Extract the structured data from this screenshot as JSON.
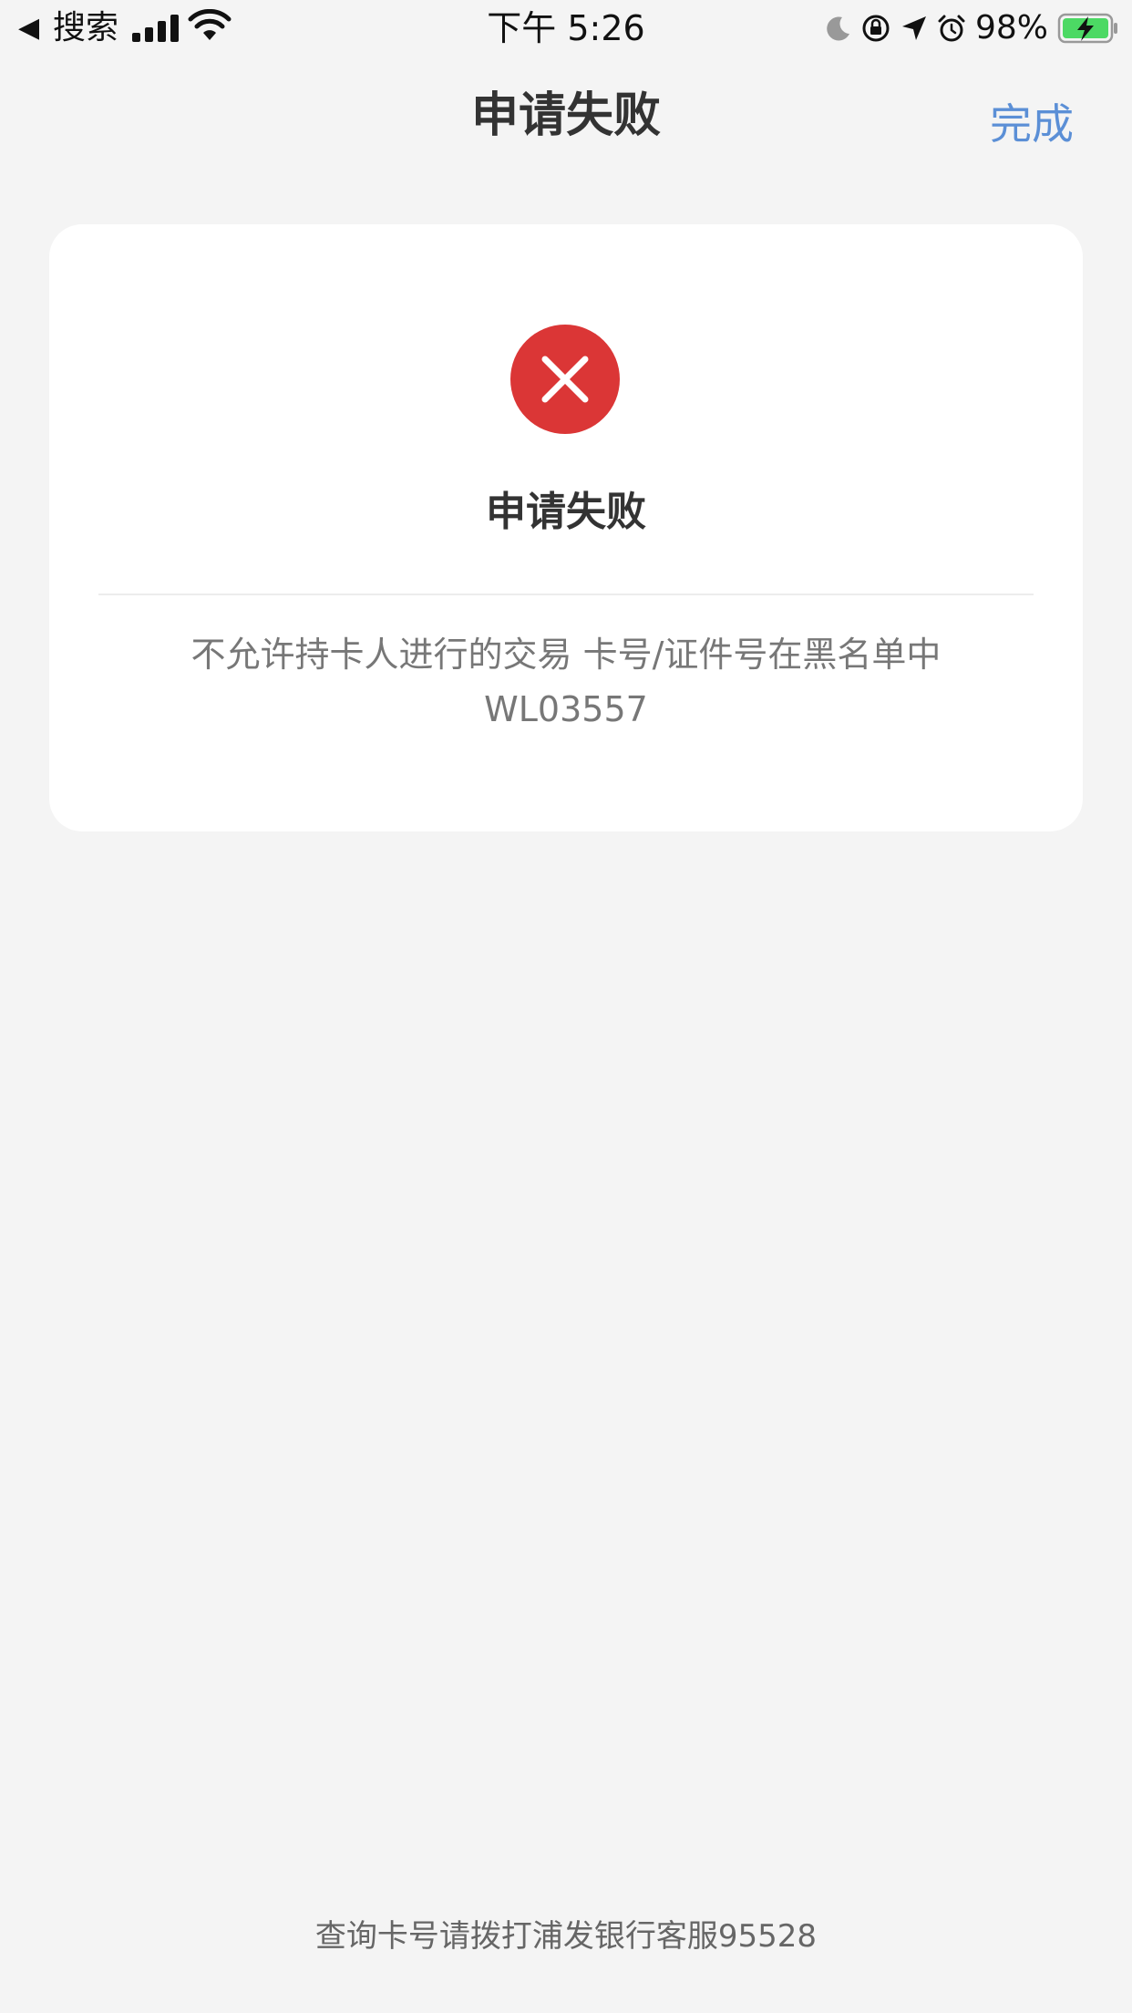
{
  "status_bar": {
    "back_glyph": "◀",
    "back_label": "搜索",
    "time": "下午 5:26",
    "battery_percent": "98%",
    "icons": [
      "signal-icon",
      "wifi-icon",
      "moon-icon",
      "rotation-lock-icon",
      "location-icon",
      "alarm-icon",
      "battery-charging-icon"
    ]
  },
  "nav": {
    "title": "申请失败",
    "done_label": "完成"
  },
  "result": {
    "status_icon": "error-x-icon",
    "title": "申请失败",
    "message_line1": "不允许持卡人进行的交易 卡号/证件号在黑名单中",
    "message_line2": "WL03557"
  },
  "footer": {
    "note": "查询卡号请拨打浦发银行客服95528"
  },
  "colors": {
    "background": "#f4f4f4",
    "card": "#ffffff",
    "accent_link": "#5b8fd6",
    "error": "#db3636",
    "battery_fill": "#4cd964"
  }
}
